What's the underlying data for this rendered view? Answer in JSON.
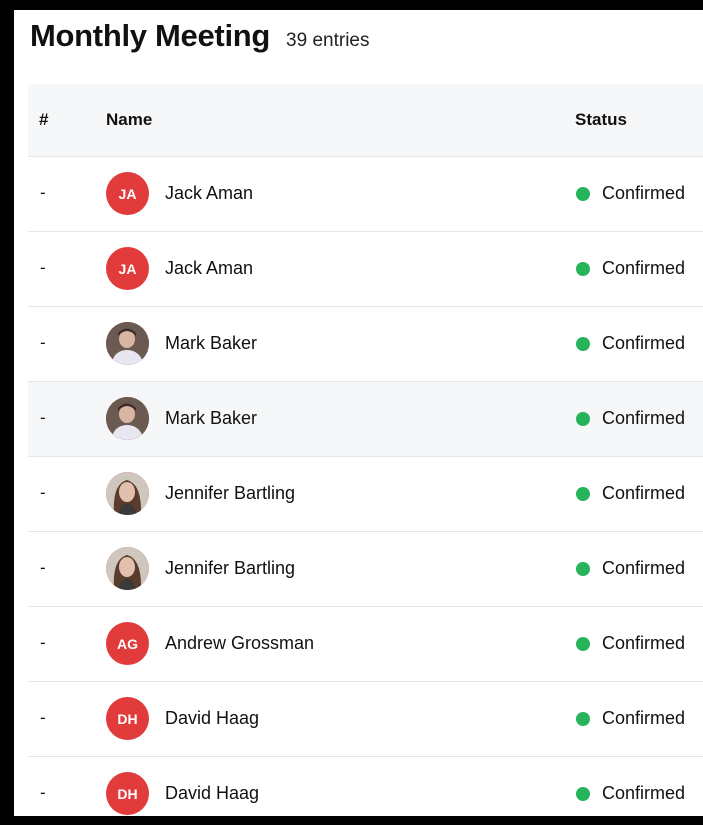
{
  "header": {
    "title": "Monthly Meeting",
    "count": "39 entries"
  },
  "columns": {
    "num": "#",
    "name": "Name",
    "status": "Status"
  },
  "status_color": "#26b35a",
  "avatar_color": "#e23b3b",
  "rows": [
    {
      "num": "-",
      "name": "Jack Aman",
      "initials": "JA",
      "status": "Confirmed"
    },
    {
      "num": "-",
      "name": "Jack Aman",
      "initials": "JA",
      "status": "Confirmed"
    },
    {
      "num": "-",
      "name": "Mark Baker",
      "initials": "",
      "status": "Confirmed"
    },
    {
      "num": "-",
      "name": "Mark Baker",
      "initials": "",
      "status": "Confirmed"
    },
    {
      "num": "-",
      "name": "Jennifer Bartling",
      "initials": "",
      "status": "Confirmed"
    },
    {
      "num": "-",
      "name": "Jennifer Bartling",
      "initials": "",
      "status": "Confirmed"
    },
    {
      "num": "-",
      "name": "Andrew Grossman",
      "initials": "AG",
      "status": "Confirmed"
    },
    {
      "num": "-",
      "name": "David Haag",
      "initials": "DH",
      "status": "Confirmed"
    },
    {
      "num": "-",
      "name": "David Haag",
      "initials": "DH",
      "status": "Confirmed"
    }
  ]
}
